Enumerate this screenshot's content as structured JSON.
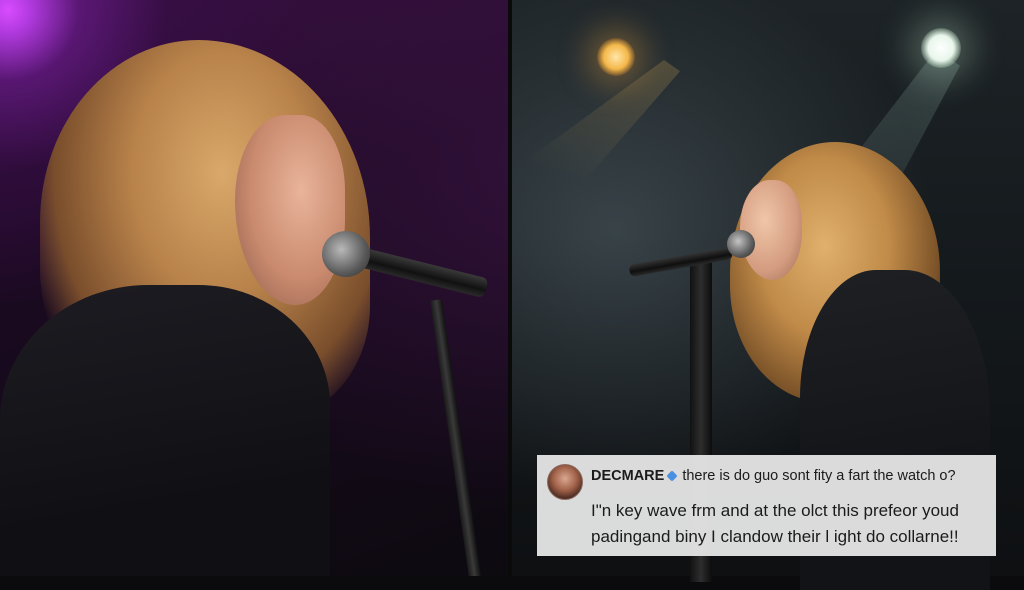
{
  "comment": {
    "username": "DECMARE",
    "headline": "there is do guo sont fity a fart the watch o?",
    "body": "I\"n key wave frm and at the olct this prefeor youd padingand biny I clandow their l ight do collarne!!"
  },
  "icons": {
    "avatar": "user-avatar-icon",
    "verified": "verified-badge-icon"
  },
  "colors": {
    "left_stage_light": "#b23ae0",
    "warm_spot": "#f5b84a",
    "cool_spot": "#e8f6ea",
    "verified": "#4a90e2",
    "overlay_bg": "#e8e8e8"
  }
}
